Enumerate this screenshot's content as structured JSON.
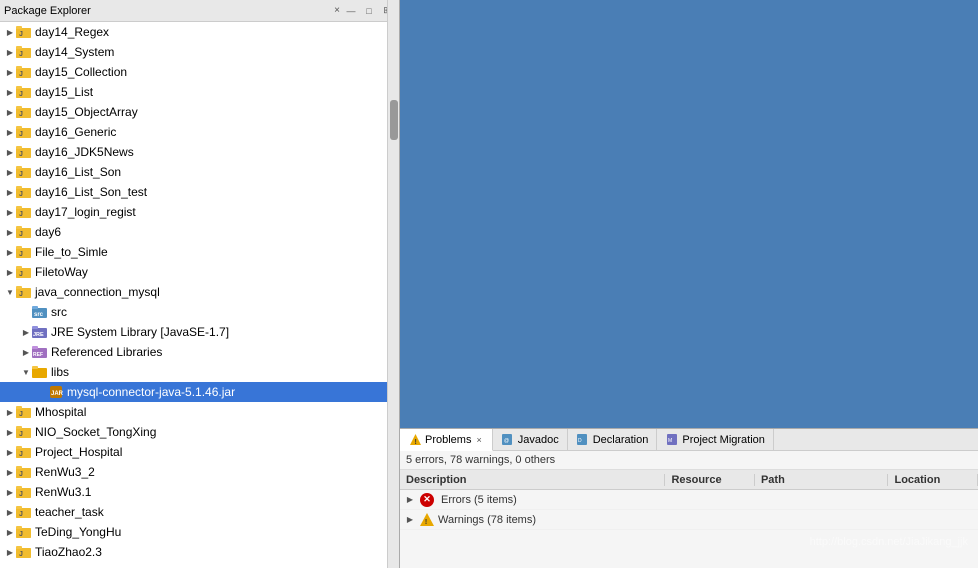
{
  "leftPanel": {
    "title": "Package Explorer",
    "closeLabel": "×"
  },
  "treeItems": [
    {
      "id": "day14_Regex",
      "label": "day14_Regex",
      "indent": 0,
      "arrow": "closed",
      "type": "project"
    },
    {
      "id": "day14_System",
      "label": "day14_System",
      "indent": 0,
      "arrow": "closed",
      "type": "project"
    },
    {
      "id": "day15_Collection",
      "label": "day15_Collection",
      "indent": 0,
      "arrow": "closed",
      "type": "project"
    },
    {
      "id": "day15_List",
      "label": "day15_List",
      "indent": 0,
      "arrow": "closed",
      "type": "project"
    },
    {
      "id": "day15_ObjectArray",
      "label": "day15_ObjectArray",
      "indent": 0,
      "arrow": "closed",
      "type": "project"
    },
    {
      "id": "day16_Generic",
      "label": "day16_Generic",
      "indent": 0,
      "arrow": "closed",
      "type": "project"
    },
    {
      "id": "day16_JDK5News",
      "label": "day16_JDK5News",
      "indent": 0,
      "arrow": "closed",
      "type": "project"
    },
    {
      "id": "day16_List_Son",
      "label": "day16_List_Son",
      "indent": 0,
      "arrow": "closed",
      "type": "project"
    },
    {
      "id": "day16_List_Son_test",
      "label": "day16_List_Son_test",
      "indent": 0,
      "arrow": "closed",
      "type": "project"
    },
    {
      "id": "day17_login_regist",
      "label": "day17_login_regist",
      "indent": 0,
      "arrow": "closed",
      "type": "project"
    },
    {
      "id": "day6",
      "label": "day6",
      "indent": 0,
      "arrow": "closed",
      "type": "project"
    },
    {
      "id": "File_to_Simle",
      "label": "File_to_Simle",
      "indent": 0,
      "arrow": "closed",
      "type": "project"
    },
    {
      "id": "FiletoWay",
      "label": "FiletoWay",
      "indent": 0,
      "arrow": "closed",
      "type": "project"
    },
    {
      "id": "java_connection_mysql",
      "label": "java_connection_mysql",
      "indent": 0,
      "arrow": "open",
      "type": "project"
    },
    {
      "id": "src",
      "label": "src",
      "indent": 1,
      "arrow": "empty",
      "type": "src"
    },
    {
      "id": "jre_system",
      "label": "JRE System Library [JavaSE-1.7]",
      "indent": 1,
      "arrow": "closed",
      "type": "jre"
    },
    {
      "id": "ref_libs",
      "label": "Referenced Libraries",
      "indent": 1,
      "arrow": "closed",
      "type": "ref"
    },
    {
      "id": "libs",
      "label": "libs",
      "indent": 1,
      "arrow": "open",
      "type": "folder"
    },
    {
      "id": "mysql_jar",
      "label": "mysql-connector-java-5.1.46.jar",
      "indent": 2,
      "arrow": "empty",
      "type": "jar",
      "selected": true
    },
    {
      "id": "Mhospital",
      "label": "Mhospital",
      "indent": 0,
      "arrow": "closed",
      "type": "project"
    },
    {
      "id": "NIO_Socket_TongXing",
      "label": "NIO_Socket_TongXing",
      "indent": 0,
      "arrow": "closed",
      "type": "project"
    },
    {
      "id": "Project_Hospital",
      "label": "Project_Hospital",
      "indent": 0,
      "arrow": "closed",
      "type": "project"
    },
    {
      "id": "RenWu3_2",
      "label": "RenWu3_2",
      "indent": 0,
      "arrow": "closed",
      "type": "project"
    },
    {
      "id": "RenWu3.1",
      "label": "RenWu3.1",
      "indent": 0,
      "arrow": "closed",
      "type": "project"
    },
    {
      "id": "teacher_task",
      "label": "teacher_task",
      "indent": 0,
      "arrow": "closed",
      "type": "project"
    },
    {
      "id": "TeDing_YongHu",
      "label": "TeDing_YongHu",
      "indent": 0,
      "arrow": "closed",
      "type": "project"
    },
    {
      "id": "TiaoZhao2.3",
      "label": "TiaoZhao2.3",
      "indent": 0,
      "arrow": "closed",
      "type": "project"
    }
  ],
  "bottomPanel": {
    "tabs": [
      {
        "id": "problems",
        "label": "Problems",
        "active": true,
        "closeable": true,
        "icon": "warning"
      },
      {
        "id": "javadoc",
        "label": "Javadoc",
        "active": false,
        "closeable": false,
        "icon": "doc"
      },
      {
        "id": "declaration",
        "label": "Declaration",
        "active": false,
        "closeable": false,
        "icon": "decl"
      },
      {
        "id": "project_migration",
        "label": "Project Migration",
        "active": false,
        "closeable": false,
        "icon": "migrate"
      }
    ],
    "statusText": "5 errors, 78 warnings, 0 others",
    "columns": [
      "Description",
      "Resource",
      "Path",
      "Location"
    ],
    "rows": [
      {
        "type": "error",
        "label": "Errors (5 items)",
        "resource": "",
        "path": "",
        "location": ""
      },
      {
        "type": "warning",
        "label": "Warnings (78 items)",
        "resource": "",
        "path": "",
        "location": ""
      }
    ]
  },
  "watermark": "http://blog.csdn.net/JiaJikang_jjk"
}
